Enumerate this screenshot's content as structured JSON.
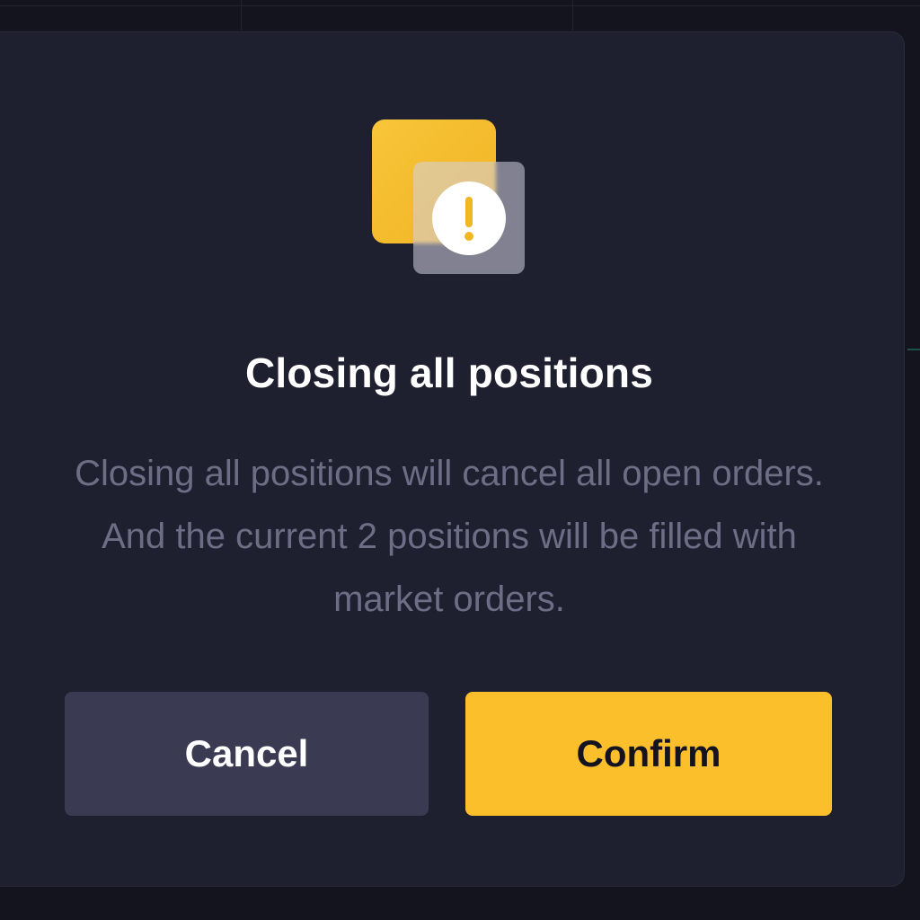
{
  "dialog": {
    "title": "Closing all positions",
    "message": "Closing all positions will cancel all open orders. And the current 2 positions will be filled with market orders.",
    "icon": "warning-icon",
    "cancel_label": "Cancel",
    "confirm_label": "Confirm"
  },
  "colors": {
    "background": "#13141d",
    "dialog_bg": "#1f202f",
    "accent": "#fbbf2b",
    "cancel_bg": "#3a3b53",
    "title_text": "#ffffff",
    "message_text": "#6d6e86"
  }
}
